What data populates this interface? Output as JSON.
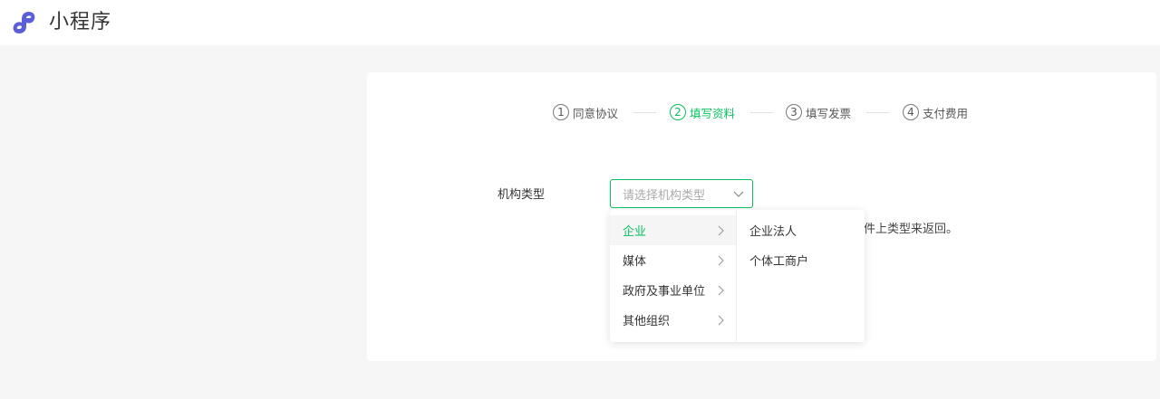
{
  "app": {
    "title": "小程序",
    "logo_icon": "mini-program-logo-icon",
    "brand_color": "#5a5fd8"
  },
  "steps": [
    {
      "num": "1",
      "label": "同意协议",
      "active": false
    },
    {
      "num": "2",
      "label": "填写资料",
      "active": true
    },
    {
      "num": "3",
      "label": "填写发票",
      "active": false
    },
    {
      "num": "4",
      "label": "支付费用",
      "active": false
    }
  ],
  "form": {
    "org_type_label": "机构类型",
    "org_type_placeholder": "请选择机构类型",
    "hint_visible_tail": "件上类型来返回。"
  },
  "dropdown": {
    "categories": [
      {
        "label": "企业",
        "active": true
      },
      {
        "label": "媒体",
        "active": false
      },
      {
        "label": "政府及事业单位",
        "active": false
      },
      {
        "label": "其他组织",
        "active": false
      }
    ],
    "subtypes": [
      {
        "label": "企业法人"
      },
      {
        "label": "个体工商户"
      }
    ]
  },
  "colors": {
    "accent": "#07c160",
    "page_bg": "#f6f6f6"
  }
}
